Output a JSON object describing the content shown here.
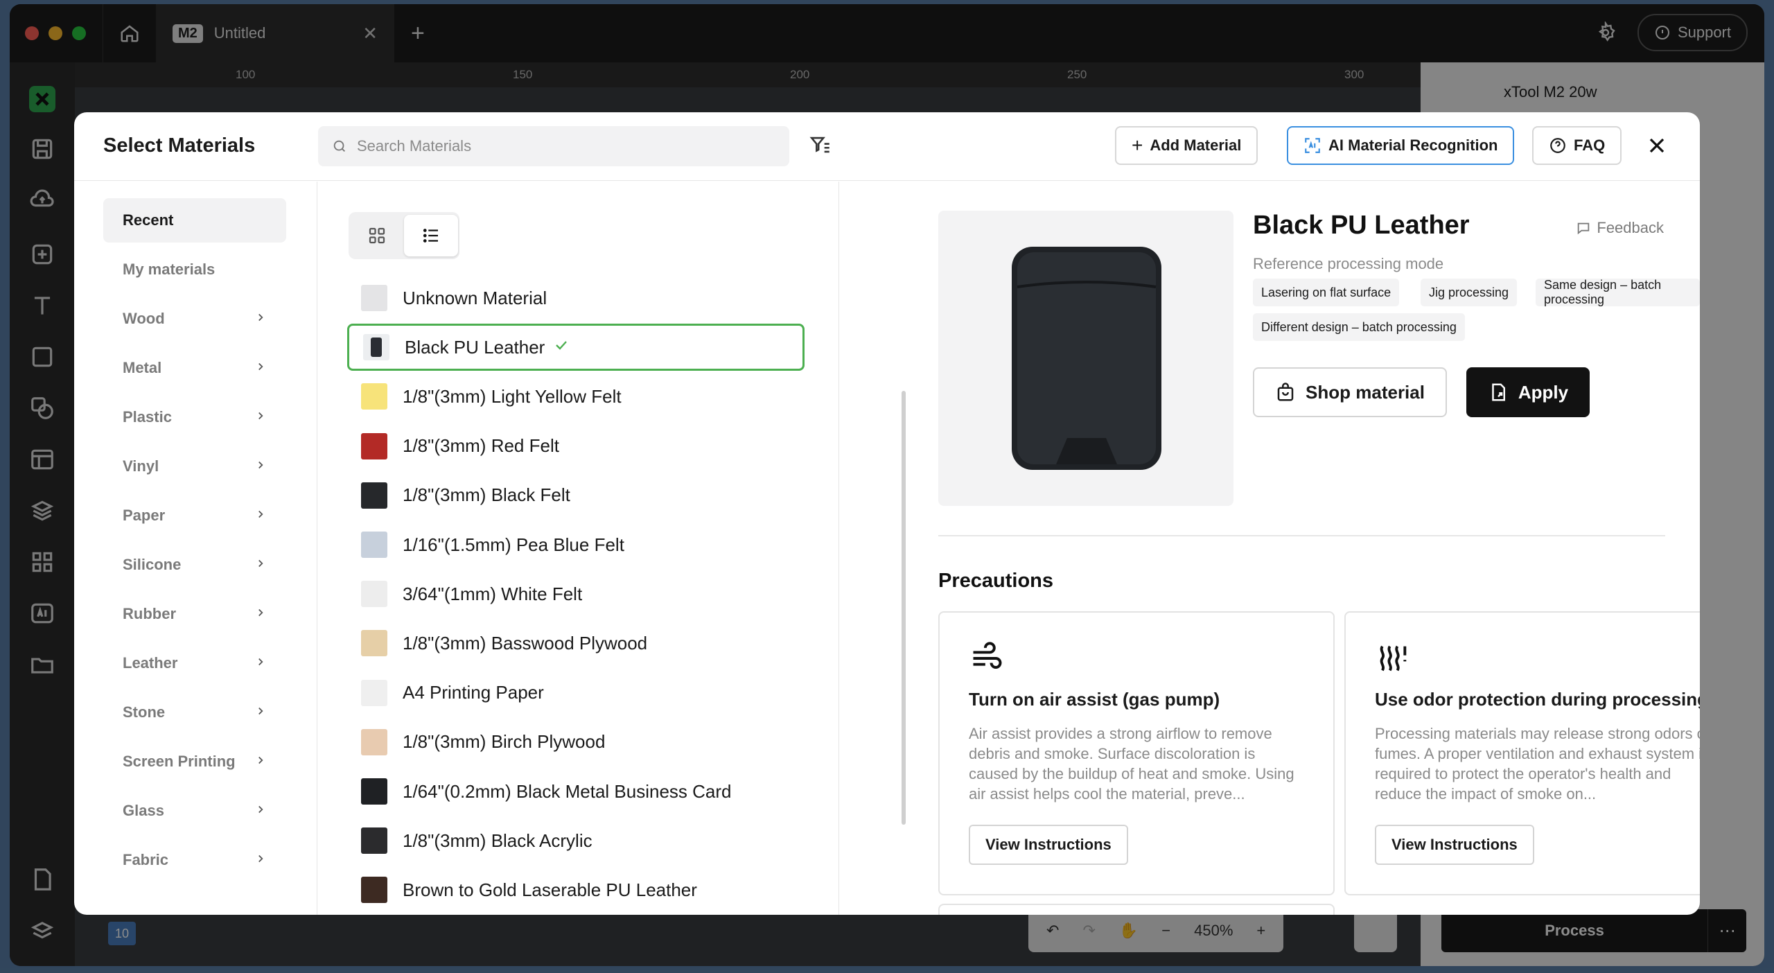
{
  "app": {
    "tab_badge": "M2",
    "tab_title": "Untitled",
    "support_label": "Support",
    "ruler_ticks": [
      "100",
      "150",
      "200",
      "250",
      "300"
    ],
    "device_name": "xTool M2 20w",
    "process_label": "Process",
    "zoom_level": "450%",
    "layer_badge": "10"
  },
  "modal": {
    "title": "Select Materials",
    "search_placeholder": "Search Materials",
    "add_material_label": "Add Material",
    "ai_recognition_label": "AI Material Recognition",
    "faq_label": "FAQ"
  },
  "nav": {
    "items": [
      {
        "label": "Recent",
        "active": true,
        "has_children": false
      },
      {
        "label": "My materials",
        "active": false,
        "has_children": false
      },
      {
        "label": "Wood",
        "active": false,
        "has_children": true
      },
      {
        "label": "Metal",
        "active": false,
        "has_children": true
      },
      {
        "label": "Plastic",
        "active": false,
        "has_children": true
      },
      {
        "label": "Vinyl",
        "active": false,
        "has_children": true
      },
      {
        "label": "Paper",
        "active": false,
        "has_children": true
      },
      {
        "label": "Silicone",
        "active": false,
        "has_children": true
      },
      {
        "label": "Rubber",
        "active": false,
        "has_children": true
      },
      {
        "label": "Leather",
        "active": false,
        "has_children": true
      },
      {
        "label": "Stone",
        "active": false,
        "has_children": true
      },
      {
        "label": "Screen Printing",
        "active": false,
        "has_children": true
      },
      {
        "label": "Glass",
        "active": false,
        "has_children": true
      },
      {
        "label": "Fabric",
        "active": false,
        "has_children": true
      }
    ]
  },
  "materials": {
    "view_mode": "list",
    "items": [
      {
        "name": "Unknown Material",
        "color": "#e4e4e6",
        "selected": false
      },
      {
        "name": "Black PU Leather",
        "color": "#2a2d33",
        "selected": true
      },
      {
        "name": "1/8\"(3mm) Light Yellow Felt",
        "color": "#f7e37a",
        "selected": false
      },
      {
        "name": "1/8\"(3mm) Red Felt",
        "color": "#b32a26",
        "selected": false
      },
      {
        "name": "1/8\"(3mm) Black Felt",
        "color": "#26282b",
        "selected": false
      },
      {
        "name": "1/16\"(1.5mm) Pea Blue Felt",
        "color": "#c7d0dc",
        "selected": false
      },
      {
        "name": "3/64\"(1mm) White Felt",
        "color": "#ededed",
        "selected": false
      },
      {
        "name": "1/8\"(3mm) Basswood Plywood",
        "color": "#e6cfa7",
        "selected": false
      },
      {
        "name": "A4 Printing Paper",
        "color": "#efefef",
        "selected": false
      },
      {
        "name": "1/8\"(3mm) Birch Plywood",
        "color": "#e8cbb0",
        "selected": false
      },
      {
        "name": "1/64\"(0.2mm) Black Metal Business Card",
        "color": "#1f2124",
        "selected": false
      },
      {
        "name": "1/8\"(3mm) Black Acrylic",
        "color": "#2b2b2d",
        "selected": false
      },
      {
        "name": "Brown to Gold Laserable PU Leather",
        "color": "#3d2a22",
        "selected": false
      }
    ]
  },
  "detail": {
    "title": "Black PU Leather",
    "feedback_label": "Feedback",
    "reference_mode_label": "Reference processing mode",
    "tags": [
      "Lasering on flat surface",
      "Jig processing",
      "Same design – batch processing",
      "Different design – batch processing"
    ],
    "shop_label": "Shop material",
    "apply_label": "Apply",
    "precautions_title": "Precautions",
    "cards": [
      {
        "icon": "air-flow-icon",
        "title": "Turn on air assist (gas pump)",
        "text": "Air assist provides a strong airflow to remove debris and smoke. Surface discoloration is caused by the buildup of heat and smoke. Using air assist helps cool the material, preve...",
        "button": "View Instructions"
      },
      {
        "icon": "odor-icon",
        "title": "Use odor protection during processing",
        "text": "Processing materials may release strong odors or fumes. A proper ventilation and exhaust system is required to protect the operator's health and reduce the impact of smoke on...",
        "button": "View Instructions"
      }
    ]
  },
  "colors": {
    "accent_green": "#4caf50",
    "ai_border": "#3a8fe0",
    "apply_bg": "#121212"
  }
}
